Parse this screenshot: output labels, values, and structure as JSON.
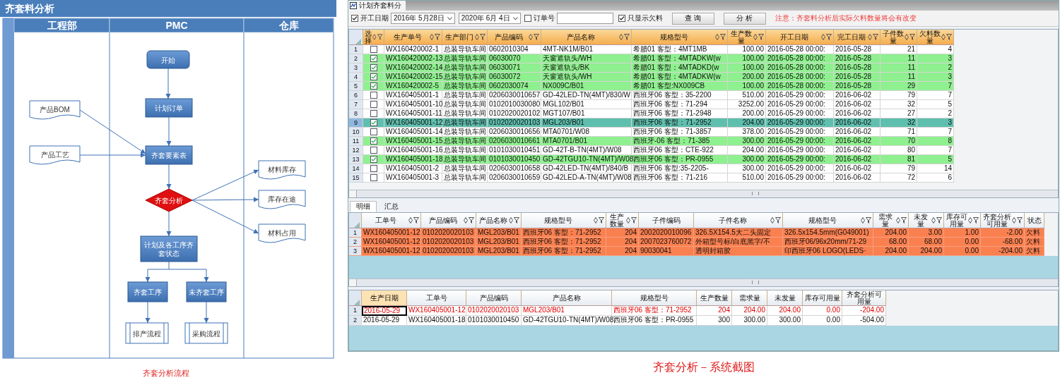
{
  "flowchart": {
    "title": "齐套料分析",
    "lanes": [
      "工程部",
      "PMC",
      "仓库"
    ],
    "nodes": [
      {
        "kind": "start",
        "label": "开始"
      },
      {
        "kind": "process",
        "label": "计划订单"
      },
      {
        "kind": "process",
        "label": "齐套要素表"
      },
      {
        "kind": "decision",
        "label": "齐套分析"
      },
      {
        "kind": "process",
        "label": "计划及各工序齐套状态"
      },
      {
        "kind": "process",
        "label": "齐套工序"
      },
      {
        "kind": "process",
        "label": "未齐套工序"
      },
      {
        "kind": "subprocess",
        "label": "排产流程"
      },
      {
        "kind": "subprocess",
        "label": "采购流程"
      },
      {
        "kind": "document",
        "label": "产品BOM"
      },
      {
        "kind": "document",
        "label": "产品工艺"
      },
      {
        "kind": "document",
        "label": "材料库存"
      },
      {
        "kind": "document",
        "label": "库存在途"
      },
      {
        "kind": "document",
        "label": "材料占用"
      }
    ],
    "caption": "齐套分析流程"
  },
  "system": {
    "window_title": "计划齐套料分",
    "toolbar": {
      "start_date": {
        "label": "开工日期",
        "checked": true
      },
      "date_from": "2016年 5月28日",
      "date_to": "2020年 6月 4日",
      "order": {
        "label": "订单号",
        "checked": false
      },
      "shortage_only": {
        "label": "只显示欠料",
        "checked": true
      },
      "buttons": [
        "查 询",
        "分 析"
      ],
      "notice": "注意：齐套料分析后实际欠料数量将会有改变"
    },
    "main_grid": {
      "select_column": {
        "label": "选择",
        "filter": true
      },
      "columns": [
        {
          "label": "生产单号",
          "filter": true
        },
        {
          "label": "生产部门",
          "filter": true
        },
        {
          "label": "产品编码",
          "filter": true
        },
        {
          "label": "产品名称",
          "filter": true
        },
        {
          "label": "规格型号",
          "filter": true
        },
        {
          "label": "生产数量",
          "filter": true
        },
        {
          "label": "开工日期",
          "filter": true
        },
        {
          "label": "完工日期",
          "filter": true
        },
        {
          "label": "子件数量",
          "filter": true
        },
        {
          "label": "欠料数量",
          "filter": true
        }
      ],
      "rows": [
        {
          "num": "1",
          "checked": false,
          "current": false,
          "cells": [
            "WX160420002-1",
            "总装导轨车间",
            "0602010304",
            "4MT-NK1M/B01",
            "希腊01  客型：4MT1MB",
            "100.00",
            "2016-05-28 00:00:",
            "2016-05-28",
            "21",
            "4"
          ]
        },
        {
          "num": "2",
          "checked": true,
          "current": false,
          "cells": [
            "WX160420002-13",
            "总装导轨车间",
            "06030070",
            "天窗遮轨头/WH",
            "希腊01  客型：4MTADKW(w",
            "100.00",
            "2016-05-28 00:00:",
            "2016-05-28",
            "11",
            "3"
          ]
        },
        {
          "num": "3",
          "checked": true,
          "current": false,
          "cells": [
            "WX160420002-14",
            "总装导轨车间",
            "06030071",
            "天窗遮轨头/BK",
            "希腊01  客型：4MTADKD(w",
            "100.00",
            "2016-05-28 00:00:",
            "2016-05-28",
            "11",
            "2"
          ]
        },
        {
          "num": "4",
          "checked": true,
          "current": false,
          "cells": [
            "WX160420002-15",
            "总装导轨车间",
            "06030072",
            "天窗遮轨头/WH",
            "希腊01  客型：4MTADKW(w",
            "200.00",
            "2016-05-28 00:00:",
            "2016-05-28",
            "11",
            "3"
          ]
        },
        {
          "num": "5",
          "checked": true,
          "current": false,
          "cells": [
            "WX160420002-5",
            "总装导轨车间",
            "0602030074",
            "NX009C/B01",
            "希腊01  客型:NX009CB",
            "100.00",
            "2016-05-28 00:00:",
            "2016-05-28",
            "29",
            "7"
          ]
        },
        {
          "num": "6",
          "checked": false,
          "current": false,
          "cells": [
            "WX160405001-1",
            "总装导轨车间",
            "0206030010657",
            "GD-42LED-TN(4MT)/830/W",
            "西班牙06  客型：35-2200",
            "510.00",
            "2016-05-29 00:00:",
            "2016-06-02",
            "79",
            "7"
          ]
        },
        {
          "num": "7",
          "checked": false,
          "current": false,
          "cells": [
            "WX160405001-10",
            "总装导轨车间",
            "0102010030080",
            "MGL102/B01",
            "西班牙06  客型：71-294",
            "3252.00",
            "2016-05-29 00:00:",
            "2016-06-02",
            "32",
            "5"
          ]
        },
        {
          "num": "8",
          "checked": false,
          "current": false,
          "cells": [
            "WX160405001-11",
            "总装导轨车间",
            "0102020020102",
            "MGT107/B01",
            "西班牙06  客型：71-2948",
            "200.00",
            "2016-05-29 00:00:",
            "2016-06-02",
            "27",
            "2"
          ]
        },
        {
          "num": "9",
          "checked": true,
          "current": true,
          "cells": [
            "WX160405001-12",
            "总装导轨车间",
            "0102020020103",
            "MGL203/B01",
            "西班牙06  客型：71-2952",
            "204.00",
            "2016-05-29 00:00:",
            "2016-06-02",
            "32",
            "3"
          ]
        },
        {
          "num": "10",
          "checked": false,
          "current": false,
          "cells": [
            "WX160405001-14",
            "总装导轨车间",
            "0206030010656",
            "MTA0701/W08",
            "西班牙06  客型：71-3857",
            "378.00",
            "2016-05-29 00:00:",
            "2016-06-02",
            "71",
            "7"
          ]
        },
        {
          "num": "11",
          "checked": true,
          "current": false,
          "cells": [
            "WX160405001-15",
            "总装导轨车间",
            "0206030010661",
            "MTA0701/B01",
            "西班牙-06  客型：71-385",
            "300.00",
            "2016-05-29 00:00:",
            "2016-06-02",
            "70",
            "8"
          ]
        },
        {
          "num": "12",
          "checked": false,
          "current": false,
          "cells": [
            "WX160405001-16",
            "总装导轨车间",
            "0101030010451",
            "GD-42T-B-TN(4MT)/W08",
            "西班牙06  客型：CTE-922",
            "204.00",
            "2016-05-29 00:00:",
            "2016-06-02",
            "80",
            "7"
          ]
        },
        {
          "num": "13",
          "checked": true,
          "current": false,
          "cells": [
            "WX160405001-18",
            "总装导轨车间",
            "0101030010450",
            "GD-42TGU10-TN(4MT)/W08",
            "西班牙06  客型：PR-0955",
            "300.00",
            "2016-05-29 00:00:",
            "2016-06-02",
            "81",
            "5"
          ]
        },
        {
          "num": "14",
          "checked": false,
          "current": false,
          "cells": [
            "WX160405001-2",
            "总装导轨车间",
            "0206030010658",
            "GD-42LED-TN(4MT)/840/B",
            "西班牙06  客型:35-2205-",
            "300.00",
            "2016-05-29 00:00:",
            "2016-06-02",
            "79",
            "14"
          ]
        },
        {
          "num": "15",
          "checked": false,
          "current": false,
          "cells": [
            "WX160405001-3",
            "总装导轨车间",
            "0206030010659",
            "GD-42LED-A-TN(4MT)/W08",
            "西班牙06  客型：71-216",
            "510.00",
            "2016-05-29 00:00:",
            "2016-06-02",
            "72",
            "6"
          ]
        }
      ]
    },
    "tabs": [
      {
        "label": "明细",
        "selected": true
      },
      {
        "label": "汇总",
        "selected": false
      }
    ],
    "detail_grid": {
      "columns": [
        {
          "label": "工单号",
          "filter": true
        },
        {
          "label": "产品编码",
          "filter": true
        },
        {
          "label": "产品名称",
          "filter": true
        },
        {
          "label": "规格型号",
          "filter": true
        },
        {
          "label": "生产数量",
          "filter": true
        },
        {
          "label": "子件编码",
          "filter": false
        },
        {
          "label": "子件名称",
          "filter": true
        },
        {
          "label": "规格型号",
          "filter": true
        },
        {
          "label": "需求量",
          "filter": true
        },
        {
          "label": "未发量",
          "filter": true
        },
        {
          "label": "库存可用量",
          "filter": true
        },
        {
          "label": "齐套分析可用量",
          "filter": true
        },
        {
          "label": "状态",
          "filter": false
        }
      ],
      "rows": [
        {
          "num": "1",
          "cells": [
            "WX160405001-12",
            "0102020020103",
            "MGL203/B01",
            "西班牙06  客型：71-2952",
            "204",
            "2002020010096",
            "326.5X154.5大二头固定",
            "326.5x154.5mm(G049001)",
            "204.00",
            "3.00",
            "1.00",
            "-2.00",
            "欠料"
          ]
        },
        {
          "num": "2",
          "cells": [
            "WX160405001-12",
            "0102020020103",
            "MGL203/B01",
            "西班牙06  客型：71-2952",
            "204",
            "2007023760072",
            "外箱型号标/白底黑字/不",
            "西班牙06/96x20mm/71-29",
            "68.00",
            "68.00",
            "0.00",
            "-68.00",
            "欠料"
          ]
        },
        {
          "num": "3",
          "cells": [
            "WX160405001-12",
            "0102020020103",
            "MGL203/B01",
            "西班牙06  客型：71-2952",
            "204",
            "90030041",
            "透明封箱胶",
            "印西班牙06 LOGO(LEDS·",
            "204.00",
            "204.00",
            "0.00",
            "-204.00",
            "欠料"
          ]
        }
      ]
    },
    "summary_grid": {
      "columns": [
        "生产日期",
        "工单号",
        "产品编码",
        "产品名称",
        "规格型号",
        "生产数量",
        "需求量",
        "未发量",
        "库存可用量",
        "齐套分析可用量"
      ],
      "rows": [
        {
          "num": "1",
          "selected": true,
          "cells": [
            "2016-05-29",
            "WX160405001-12",
            "0102020020103",
            "MGL203/B01",
            "西班牙06  客型：71-2952",
            "204",
            "204.00",
            "204.00",
            "0.00",
            "-204.00"
          ]
        },
        {
          "num": "2",
          "selected": false,
          "cells": [
            "2016-05-29",
            "WX160405001-18",
            "0101030010450",
            "GD-42TGU10-TN(4MT)/W08",
            "西班牙06  客型：PR-0955",
            "300",
            "300.00",
            "300.00",
            "0.00",
            "-504.00"
          ]
        }
      ]
    },
    "caption": "齐套分析－系统截图"
  }
}
